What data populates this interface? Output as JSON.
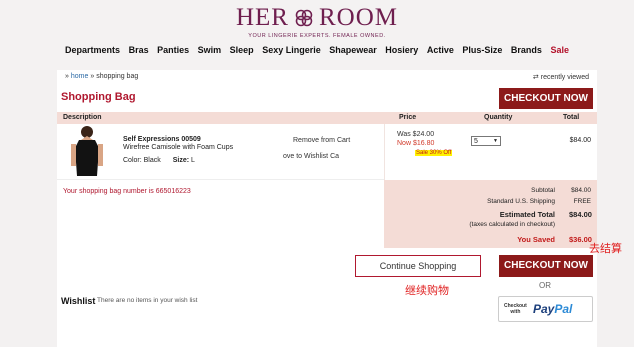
{
  "brand": {
    "logo_left": "HER",
    "logo_right": "ROOM",
    "tagline": "YOUR LINGERIE EXPERTS. FEMALE OWNED."
  },
  "nav": [
    {
      "label": "Departments"
    },
    {
      "label": "Bras"
    },
    {
      "label": "Panties"
    },
    {
      "label": "Swim"
    },
    {
      "label": "Sleep"
    },
    {
      "label": "Sexy Lingerie"
    },
    {
      "label": "Shapewear"
    },
    {
      "label": "Hosiery"
    },
    {
      "label": "Active"
    },
    {
      "label": "Plus-Size"
    },
    {
      "label": "Brands"
    },
    {
      "label": "Sale"
    }
  ],
  "breadcrumb": {
    "sep": "»",
    "home": "home",
    "current": "shopping bag"
  },
  "recently_viewed": "recently viewed",
  "page_title": "Shopping Bag",
  "checkout_label": "CHECKOUT NOW",
  "table_headers": {
    "description": "Description",
    "price": "Price",
    "quantity": "Quantity",
    "total": "Total"
  },
  "item": {
    "name": "Self Expressions 00509",
    "description": "Wirefree Camisole with Foam Cups",
    "color_label": "Color:",
    "color": "Black",
    "size_label": "Size:",
    "size": "L",
    "remove": "Remove from Cart",
    "move": "ove to Wishlist Ca",
    "was": "Was $24.00",
    "now": "Now $16.80",
    "sale": "Sale 30% Off",
    "quantity": "5",
    "total": "$84.00"
  },
  "bag_number_text": "Your shopping bag number is ",
  "bag_number": "665016223",
  "summary": {
    "subtotal_label": "Subtotal",
    "subtotal": "$84.00",
    "shipping_label": "Standard U.S. Shipping",
    "shipping": "FREE",
    "estimated_label": "Estimated Total",
    "estimated": "$84.00",
    "tax_note": "(taxes calculated in checkout)",
    "saved_label": "You Saved",
    "saved": "$36.00"
  },
  "continue_label": "Continue Shopping",
  "or_label": "OR",
  "paypal": {
    "small_line1": "Checkout",
    "small_line2": "with",
    "pay": "Pay",
    "pal": "Pal"
  },
  "wishlist": {
    "title": "Wishlist",
    "text": "There are no items in your wish list"
  },
  "annotations": {
    "checkout": "去结算",
    "continue": "继续购物"
  },
  "colors": {
    "brand": "#6f1f4f",
    "accent_red": "#8c1a1a",
    "sale_red": "#b3122b",
    "summary_bg": "#f4dcd6"
  }
}
